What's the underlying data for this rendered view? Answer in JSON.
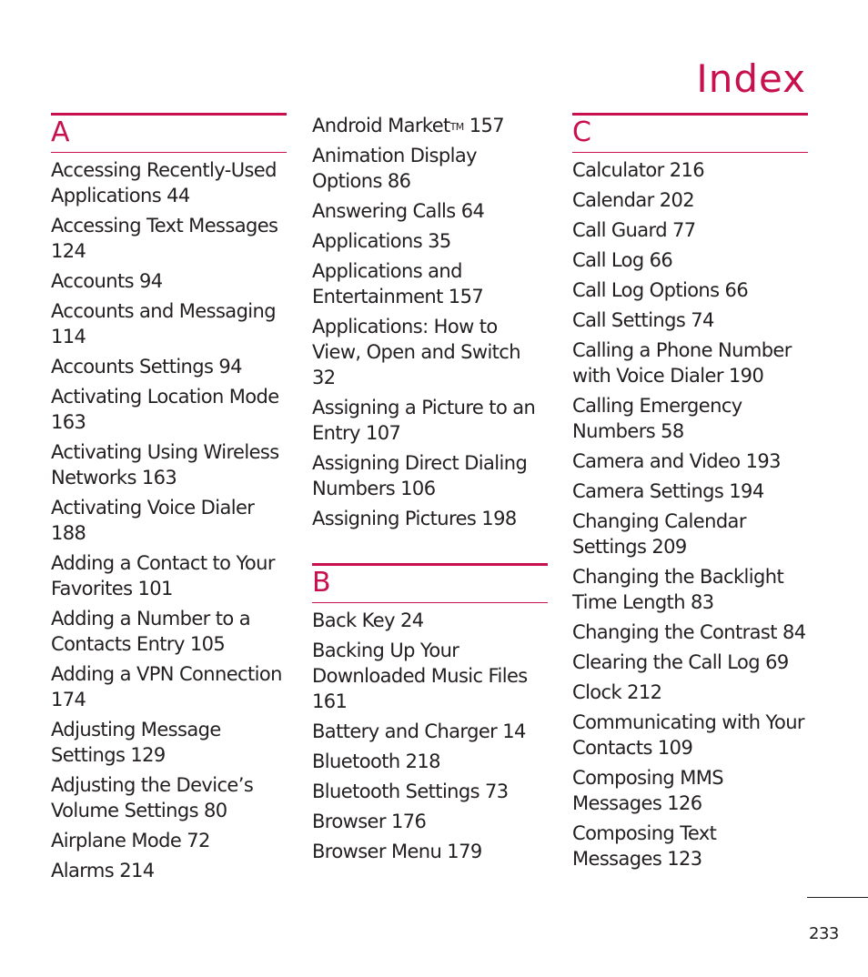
{
  "header": {
    "title": "Index"
  },
  "colors": {
    "accent": "#c8104f",
    "text": "#231f20"
  },
  "sections": {
    "A": {
      "letter": "A",
      "entries_col1": [
        "Accessing Recently-Used Applications 44",
        "Accessing Text Messages 124",
        "Accounts 94",
        "Accounts and Messaging 114",
        "Accounts Settings 94",
        "Activating Location Mode 163",
        "Activating Using Wireless Networks 163",
        "Activating Voice Dialer 188",
        "Adding a Contact to Your Favorites 101",
        "Adding a Number to a Contacts Entry 105",
        "Adding a VPN Connection 174",
        "Adjusting Message Settings 129",
        "Adjusting the Device’s Volume Settings 80",
        "Airplane Mode 72",
        "Alarms 214"
      ],
      "entries_col2": [
        "Android Market™ 157",
        "Animation Display Options 86",
        "Answering Calls 64",
        "Applications 35",
        "Applications and Entertainment 157",
        "Applications: How to View, Open and Switch 32",
        "Assigning a Picture to an Entry 107",
        "Assigning Direct Dialing Numbers 106",
        "Assigning Pictures 198"
      ]
    },
    "B": {
      "letter": "B",
      "entries": [
        "Back Key 24",
        "Backing Up Your Downloaded Music Files 161",
        "Battery and Charger 14",
        "Bluetooth 218",
        "Bluetooth Settings 73",
        "Browser 176",
        "Browser Menu 179"
      ]
    },
    "C": {
      "letter": "C",
      "entries": [
        "Calculator 216",
        "Calendar 202",
        "Call Guard 77",
        "Call Log 66",
        "Call Log Options 66",
        "Call Settings 74",
        "Calling a Phone Number with Voice Dialer 190",
        "Calling Emergency Numbers 58",
        "Camera and Video 193",
        "Camera Settings 194",
        "Changing Calendar Settings 209",
        "Changing the Backlight Time Length 83",
        "Changing the Contrast 84",
        "Clearing the Call Log 69",
        "Clock 212",
        "Communicating with Your Contacts 109",
        "Composing MMS Messages 126",
        "Composing Text Messages 123"
      ]
    }
  },
  "footer": {
    "page_number": "233"
  }
}
